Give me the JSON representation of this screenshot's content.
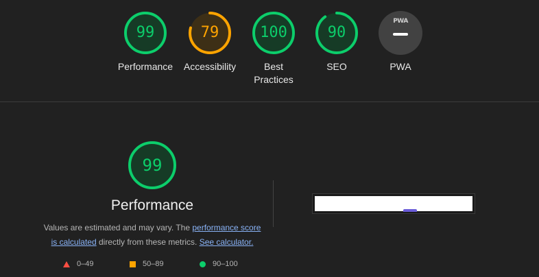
{
  "categories": [
    {
      "score": "99",
      "label": "Performance",
      "fraction": 0.99,
      "color": "#0cce6b",
      "track": "#163b26"
    },
    {
      "score": "79",
      "label": "Accessibility",
      "fraction": 0.79,
      "color": "#ffa400",
      "track": "#3d2f16"
    },
    {
      "score": "100",
      "label": "Best Practices",
      "fraction": 1.0,
      "color": "#0cce6b",
      "track": "#163b26"
    },
    {
      "score": "90",
      "label": "SEO",
      "fraction": 0.9,
      "color": "#0cce6b",
      "track": "#163b26"
    }
  ],
  "pwa": {
    "label": "PWA",
    "badge_text": "PWA",
    "icon": "pwa-badge-icon"
  },
  "performance": {
    "score": "99",
    "fraction": 0.99,
    "title": "Performance",
    "desc_part1": "Values are estimated and may vary. The ",
    "link1": "performance score is calculated",
    "desc_part2": " directly from these metrics. ",
    "link2": "See calculator."
  },
  "legend": [
    {
      "range": "0–49",
      "shape": "triangle",
      "color": "#ff4e42"
    },
    {
      "range": "50–89",
      "shape": "square",
      "color": "#ffa400"
    },
    {
      "range": "90–100",
      "shape": "circle",
      "color": "#0cce6b"
    }
  ]
}
